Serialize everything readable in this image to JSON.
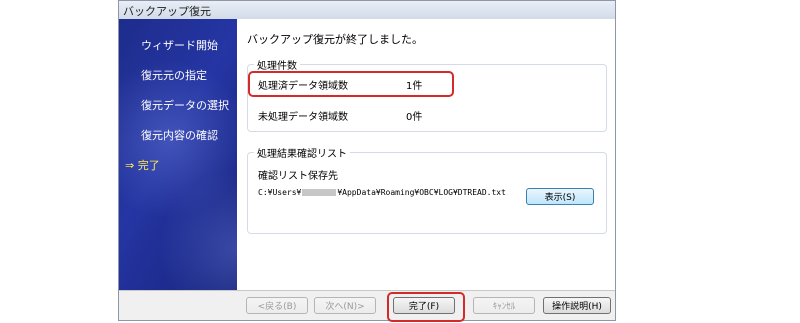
{
  "window": {
    "title": "バックアップ復元"
  },
  "sidebar": {
    "items": [
      {
        "label": "ウィザード開始"
      },
      {
        "label": "復元元の指定"
      },
      {
        "label": "復元データの選択"
      },
      {
        "label": "復元内容の確認"
      },
      {
        "label": "⇒ 完了"
      }
    ]
  },
  "main": {
    "message": "バックアップ復元が終了しました。",
    "counts": {
      "title": "処理件数",
      "processed_label": "処理済データ領域数",
      "processed_value": "1件",
      "unprocessed_label": "未処理データ領域数",
      "unprocessed_value": "0件"
    },
    "result_list": {
      "title": "処理結果確認リスト",
      "save_location_label": "確認リスト保存先",
      "path_prefix": "C:¥Users¥",
      "path_suffix": "¥AppData¥Roaming¥OBC¥LOG¥DTREAD.txt",
      "view_button": "表示(S)"
    }
  },
  "footer": {
    "back": "<戻る(B)",
    "next": "次へ(N)>",
    "finish": "完了(F)",
    "cancel": "ｷｬﾝｾﾙ",
    "help": "操作説明(H)"
  },
  "colors": {
    "highlight": "#d42a2a",
    "sidebar": "#1f2f95",
    "current_step": "#ffee55"
  }
}
